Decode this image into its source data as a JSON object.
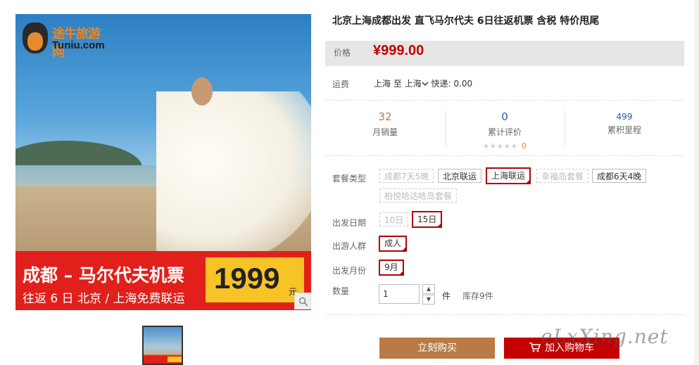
{
  "product": {
    "title": "北京上海成都出发 直飞马尔代夫 6日往返机票 含税 特价甩尾"
  },
  "image": {
    "logo_cn": "途牛旅游网",
    "logo_en": "Tuniu.com",
    "banner_title": "成都 – 马尔代夫机票",
    "banner_subtitle": "往返 6 日  北京 / 上海免费联运",
    "banner_price": "1999",
    "banner_price_unit": "元",
    "zoom_icon": "magnifier-icon"
  },
  "price": {
    "label": "价格",
    "value": "¥999.00"
  },
  "shipping": {
    "label": "运费",
    "from": "上海",
    "to_word": "至",
    "to": "上海",
    "express": "快递: 0.00"
  },
  "stats": {
    "monthly_sales": {
      "value": "32",
      "label": "月销量"
    },
    "reviews": {
      "value": "0",
      "label": "累计评价",
      "stars": "★★★★★",
      "score": "0"
    },
    "points": {
      "value": "499",
      "label": "累积里程"
    }
  },
  "sku": {
    "package_label": "套餐类型",
    "packages": [
      {
        "label": "成都7天5晚",
        "state": "disabled"
      },
      {
        "label": "北京联运",
        "state": "normal"
      },
      {
        "label": "上海联运",
        "state": "selected"
      },
      {
        "label": "幸福岛套餐",
        "state": "disabled"
      },
      {
        "label": "成都6天4晚",
        "state": "normal"
      },
      {
        "label": "柏悦哈达哈岛套餐",
        "state": "disabled"
      }
    ],
    "date_label": "出发日期",
    "dates": [
      {
        "label": "10日",
        "state": "disabled"
      },
      {
        "label": "15日",
        "state": "selected"
      }
    ],
    "people_label": "出游人群",
    "people": [
      {
        "label": "成人",
        "state": "selected"
      }
    ],
    "month_label": "出发月份",
    "months": [
      {
        "label": "9月",
        "state": "selected"
      }
    ]
  },
  "quantity": {
    "label": "数量",
    "value": "1",
    "unit": "件",
    "stock": "库存9件"
  },
  "actions": {
    "buy_now": "立刻购买",
    "add_to_cart": "加入购物车"
  },
  "watermark": "eLxXing.net",
  "colors": {
    "price_red": "#c40000",
    "buy_button": "#b97a45",
    "cart_button": "#c40000",
    "selected_border": "#b20000"
  }
}
